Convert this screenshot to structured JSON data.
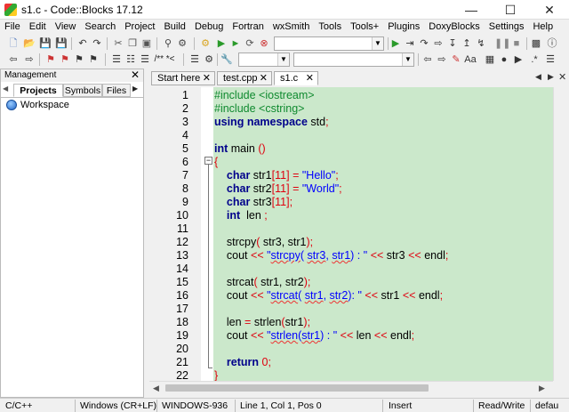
{
  "window": {
    "title": "s1.c - Code::Blocks 17.12"
  },
  "menu": [
    "File",
    "Edit",
    "View",
    "Search",
    "Project",
    "Build",
    "Debug",
    "Fortran",
    "wxSmith",
    "Tools",
    "Tools+",
    "Plugins",
    "DoxyBlocks",
    "Settings",
    "Help"
  ],
  "toolbar": {
    "search_combo_value": "",
    "target_combo_value": "",
    "search_field_value": "",
    "jump_to_comment": "/** *<"
  },
  "management": {
    "title": "Management",
    "tabs": [
      "Projects",
      "Symbols",
      "Files"
    ],
    "tree_root": "Workspace"
  },
  "editor": {
    "tabs": [
      "Start here",
      "test.cpp",
      "s1.c"
    ],
    "active_tab": "s1.c",
    "line_numbers": [
      "1",
      "2",
      "3",
      "4",
      "5",
      "6",
      "7",
      "8",
      "9",
      "10",
      "11",
      "12",
      "13",
      "14",
      "15",
      "16",
      "17",
      "18",
      "19",
      "20",
      "21",
      "22"
    ],
    "lines": [
      "#include <iostream>",
      "#include <cstring>",
      "using namespace std;",
      "",
      "int main ()",
      "{",
      "    char str1[11] = \"Hello\";",
      "    char str2[11] = \"World\";",
      "    char str3[11];",
      "    int  len ;",
      "",
      "    strcpy( str3, str1);",
      "    cout << \"strcpy( str3, str1) : \" << str3 << endl;",
      "",
      "    strcat( str1, str2);",
      "    cout << \"strcat( str1, str2): \" << str1 << endl;",
      "",
      "    len = strlen(str1);",
      "    cout << \"strlen(str1) : \" << len << endl;",
      "",
      "    return 0;",
      "}"
    ]
  },
  "status": {
    "language": "C/C++",
    "eol": "Windows (CR+LF)",
    "encoding": "WINDOWS-936",
    "position": "Line 1, Col 1, Pos 0",
    "insert_mode": "Insert",
    "access": "Read/Write",
    "extra": "defau"
  },
  "colors": {
    "code_bg": "#cbe8cb",
    "preprocessor": "#0f8a2f",
    "keyword": "#00008b",
    "string": "#0000ff",
    "operator": "#e0000e"
  }
}
